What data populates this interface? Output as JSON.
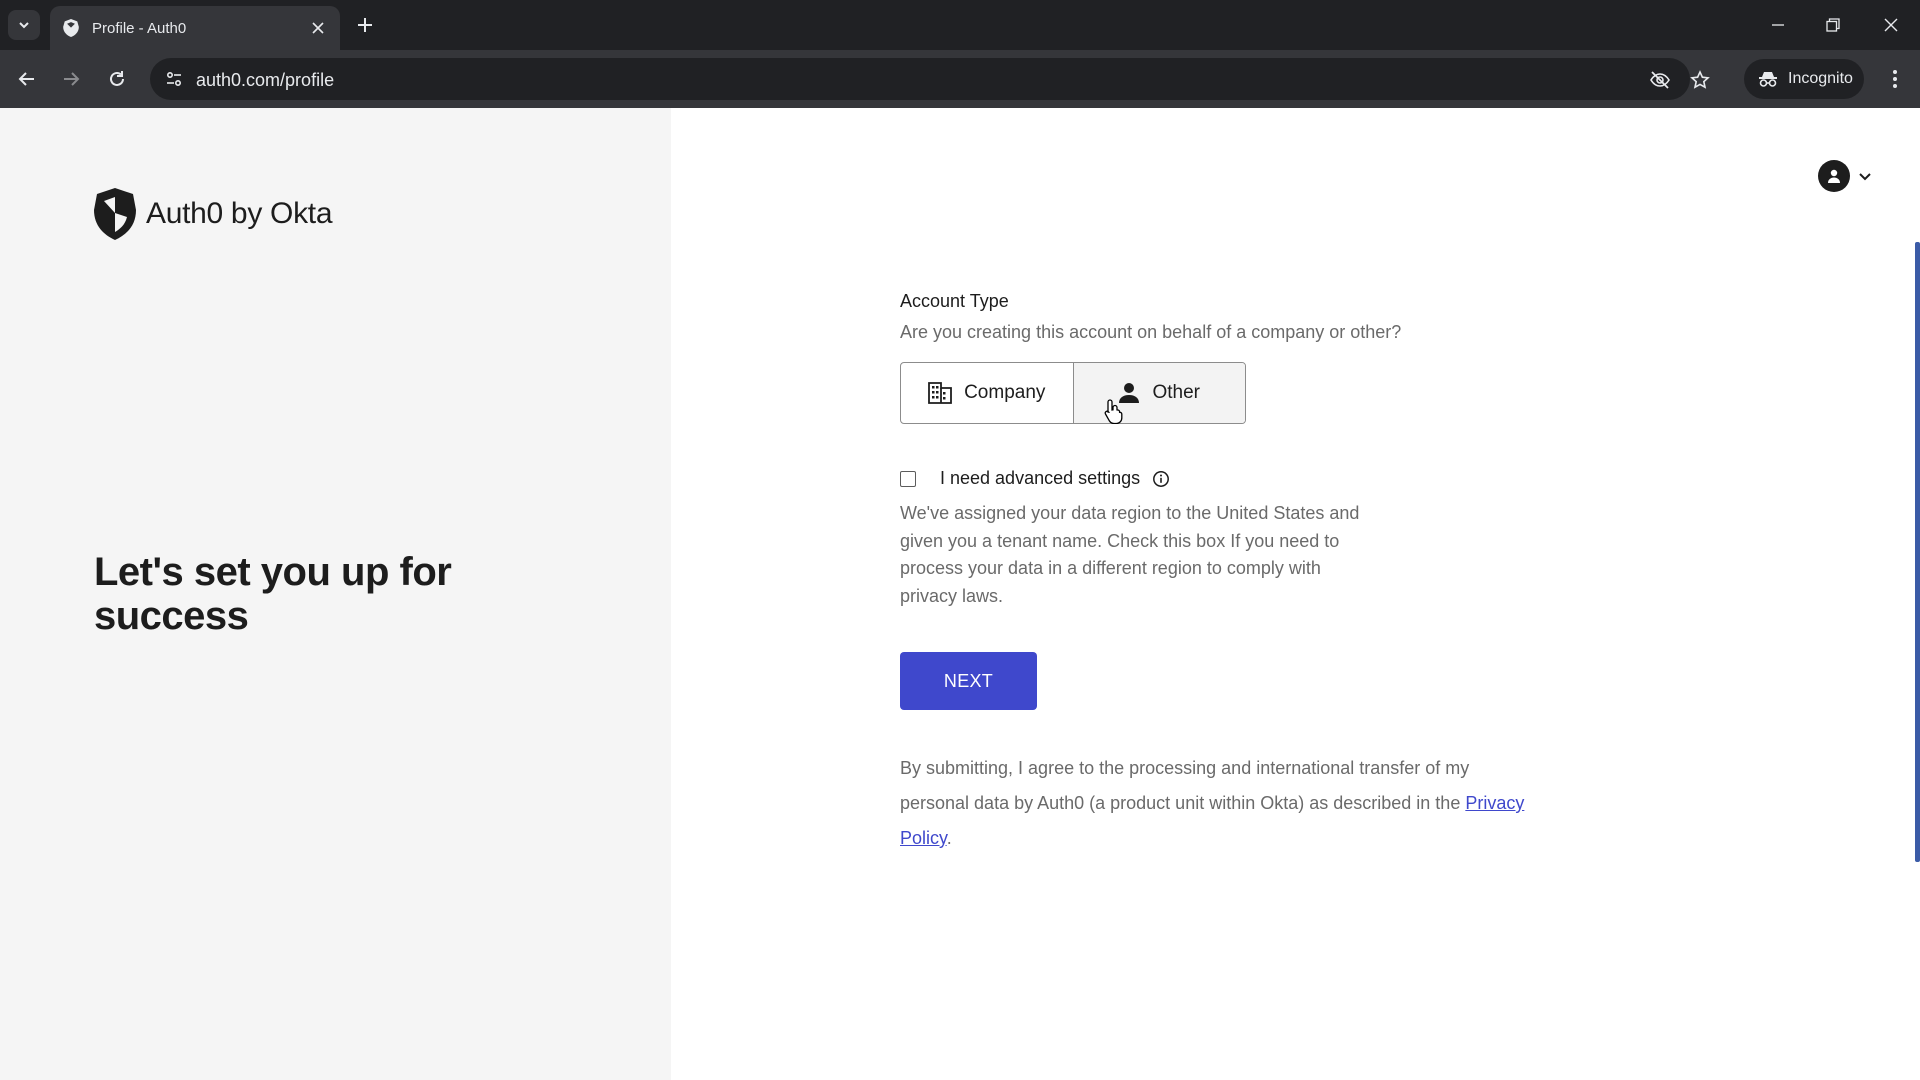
{
  "browser": {
    "tab": {
      "title": "Profile - Auth0"
    },
    "url": "auth0.com/profile",
    "incognito_label": "Incognito"
  },
  "brand": {
    "name": "Auth0 by Okta"
  },
  "hero": {
    "title": "Let's set you up for success"
  },
  "form": {
    "account_type": {
      "title": "Account Type",
      "subtitle": "Are you creating this account on behalf of a company or other?",
      "options": [
        {
          "label": "Company",
          "icon": "building-icon",
          "selected": false
        },
        {
          "label": "Other",
          "icon": "person-icon",
          "selected": true
        }
      ]
    },
    "advanced": {
      "label": "I need advanced settings",
      "checked": false,
      "help": "We've assigned your data region to the United States and given you a tenant name. Check this box If you need to process your data in a different region to comply with privacy laws."
    },
    "next_label": "NEXT",
    "legal": {
      "text": "By submitting, I agree to the processing and international transfer of my personal data by Auth0 (a product unit within Okta) as described in the ",
      "link": "Privacy Policy",
      "end": "."
    }
  },
  "colors": {
    "primary": "#3f48cc",
    "left_panel": "#f5f5f5",
    "chrome_dark": "#202124",
    "chrome_tab": "#35363a"
  }
}
